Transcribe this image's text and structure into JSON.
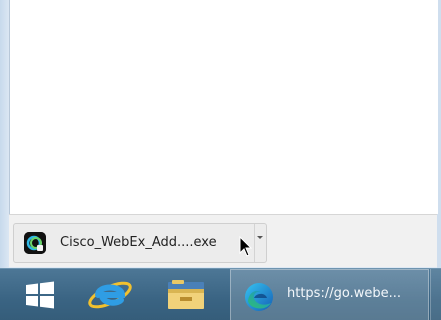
{
  "download_bar": {
    "file_name": "Cisco_WebEx_Add....exe",
    "menu_icon": "chevron-down-icon",
    "file_icon": "webex-app-icon"
  },
  "taskbar": {
    "start_icon": "windows-logo-icon",
    "pinned": [
      {
        "name": "Internet Explorer",
        "icon": "internet-explorer-icon"
      },
      {
        "name": "File Explorer",
        "icon": "file-explorer-icon"
      }
    ],
    "active_window": {
      "icon": "edge-icon",
      "title": "https://go.webe..."
    }
  },
  "colors": {
    "taskbar": "#3a6483",
    "download_bar": "#f1f1f1",
    "window_frame": "#dfe9f4"
  }
}
